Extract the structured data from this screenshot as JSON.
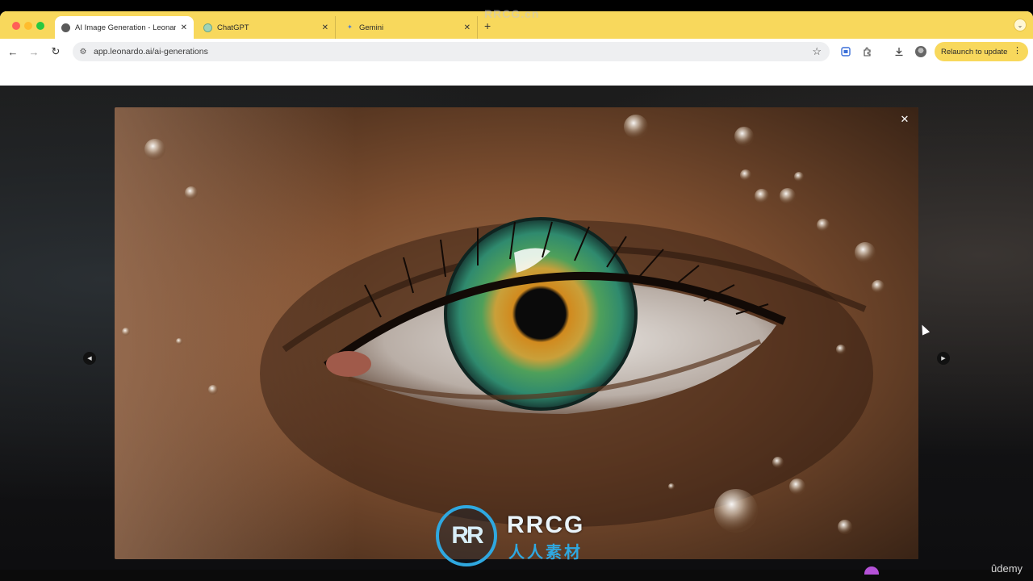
{
  "browser": {
    "tabs": [
      {
        "title": "AI Image Generation - Leonar",
        "favicon": "leonardo-favicon",
        "active": true
      },
      {
        "title": "ChatGPT",
        "favicon": "chatgpt-favicon",
        "active": false
      },
      {
        "title": "Gemini",
        "favicon": "gemini-favicon",
        "active": false
      }
    ],
    "tab_close_glyph": "✕",
    "new_tab_glyph": "+",
    "tab_search_glyph": "⌄",
    "back_glyph": "←",
    "forward_glyph": "→",
    "reload_glyph": "↻",
    "site_info_glyph": "⚙",
    "url": "app.leonardo.ai/ai-generations",
    "bookmark_glyph": "☆",
    "relaunch_label": "Relaunch to update",
    "more_glyph": "⋮",
    "accent_color": "#f8d85c"
  },
  "viewer": {
    "close_glyph": "✕",
    "prev_glyph": "◀",
    "next_glyph": "▶",
    "image_subject": "close-up of green eye with water droplets"
  },
  "watermark": {
    "top_text": "RRCG.cn",
    "logo_letters": "RR",
    "brand": "RRCG",
    "brand_sub": "人人素材",
    "udemy": "ûdemy"
  }
}
